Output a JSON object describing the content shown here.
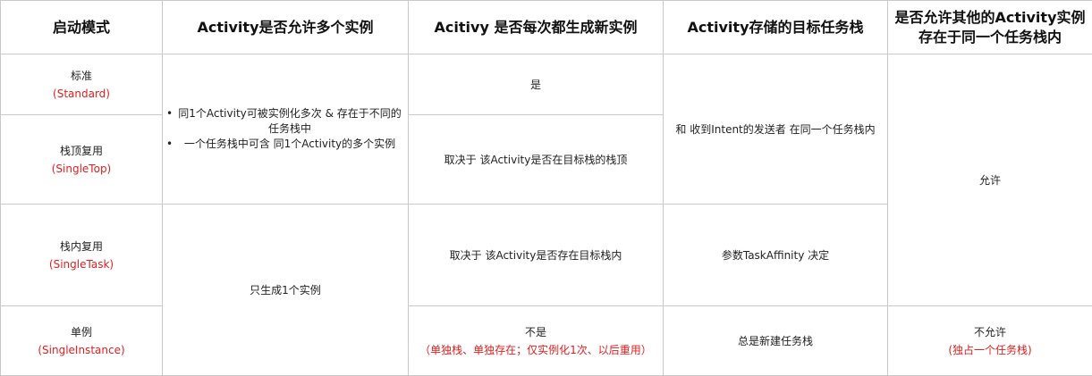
{
  "headers": {
    "mode": "启动模式",
    "multi_instance": "Activity是否允许多个实例",
    "new_each_time": "Acitivy 是否每次都生成新实例",
    "target_stack": "Activity存储的目标任务栈",
    "others_in_stack_line1": "是否允许其他的Activity实例",
    "others_in_stack_line2": "存在于同一个任务栈内"
  },
  "modes": [
    {
      "name": "标准",
      "en": "(Standard)"
    },
    {
      "name": "栈顶复用",
      "en": "(SingleTop)"
    },
    {
      "name": "栈内复用",
      "en": "(SingleTask)"
    },
    {
      "name": "单例",
      "en": "(SingleInstance)"
    }
  ],
  "multi_instance": {
    "bullet1": "同1个Activity可被实例化多次 & 存在于不同的任务栈中",
    "bullet2": "一个任务栈中可含 同1个Activity的多个实例",
    "single": "只生成1个实例"
  },
  "new_each_time": {
    "standard": "是",
    "singletop": "取决于 该Activity是否在目标栈的栈顶",
    "singletask": "取决于 该Activity是否存在目标栈内",
    "singleinstance": "不是",
    "singleinstance_note": "（单独栈、单独存在；仅实例化1次、以后重用）"
  },
  "target_stack": {
    "standard_top": "和 收到Intent的发送者 在同一个任务栈内",
    "singletask": "参数TaskAffinity 决定",
    "singleinstance": "总是新建任务栈"
  },
  "others_in_stack": {
    "allowed": "允许",
    "singleinstance": "不允许",
    "singleinstance_note": "(独占一个任务栈)"
  },
  "colors": {
    "accent_red": "#e02020",
    "border": "#c9c9c9"
  }
}
